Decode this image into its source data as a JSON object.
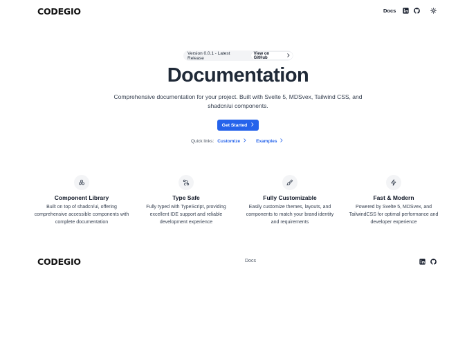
{
  "header": {
    "logo": "CODEGIO",
    "nav_docs": "Docs",
    "icons": [
      "linkedin-icon",
      "github-icon",
      "sun-icon"
    ]
  },
  "hero": {
    "version_text": "Version 0.0.1 - Latest Release",
    "github_link": "View on GitHub",
    "title": "Documentation",
    "subtitle": "Comprehensive documentation for your project. Built with Svelte 5, MDSvex, Tailwind CSS, and shadcn/ui components.",
    "cta_label": "Get Started",
    "quick_links_label": "Quick links:",
    "quick_links": [
      "Customize",
      "Examples"
    ]
  },
  "features": [
    {
      "icon": "component-icon",
      "title": "Component Library",
      "desc": "Built on top of shadcn/ui, offering comprehensive accessible components with complete documentation"
    },
    {
      "icon": "route-icon",
      "title": "Type Safe",
      "desc": "Fully typed with TypeScript, providing excellent IDE support and reliable development experience"
    },
    {
      "icon": "paintbrush-icon",
      "title": "Fully Customizable",
      "desc": "Easily customize themes, layouts, and components to match your brand identity and requirements"
    },
    {
      "icon": "zap-icon",
      "title": "Fast & Modern",
      "desc": "Powered by Svelte 5, MDSvex, and TailwindCSS for optimal performance and developer experience"
    }
  ],
  "footer": {
    "logo": "CODEGIO",
    "docs": "Docs",
    "icons": [
      "linkedin-icon",
      "github-icon"
    ]
  },
  "colors": {
    "accent": "#2563eb",
    "text": "#1f2937",
    "muted": "#374151",
    "pill_bg": "#f3f4f6"
  }
}
